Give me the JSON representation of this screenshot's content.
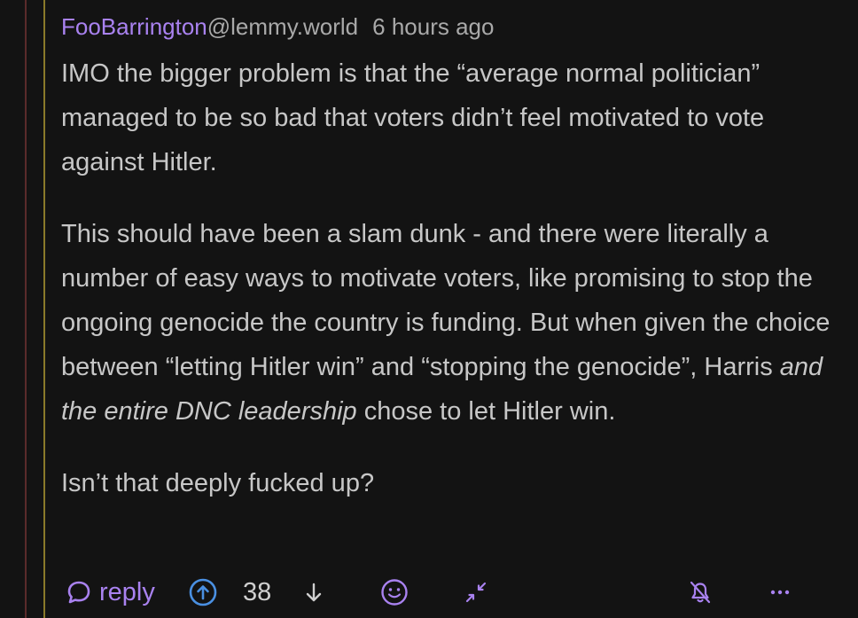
{
  "comment": {
    "username": "FooBarrington",
    "instance": "@lemmy.world",
    "timestamp": "6 hours ago",
    "paragraph1": "IMO the bigger problem is that the “average normal politician” managed to be so bad that voters didn’t feel motivated to vote against Hitler.",
    "paragraph2_before": "This should have been a slam dunk - and there were literally a number of easy ways to motivate voters, like promising to stop the ongoing genocide the country is funding. But when given the choice between “letting Hitler win” and “stopping the genocide”, Harris ",
    "paragraph2_emphasis": "and the entire DNC leadership",
    "paragraph2_after": " chose to let Hitler win.",
    "paragraph3": "Isn’t that deeply fucked up?"
  },
  "actions": {
    "reply_label": "reply",
    "score": "38"
  },
  "icons": {
    "reply": "speech-bubble-icon",
    "upvote": "arrow-up-circle-icon",
    "downvote": "arrow-down-icon",
    "emoji": "smiley-icon",
    "collapse": "collapse-arrows-icon",
    "mute": "bell-off-icon",
    "more": "more-dots-icon"
  },
  "colors": {
    "background": "#131313",
    "accent": "#a982f0",
    "upvote": "#4a90e2",
    "text": "#c7c7c7",
    "muted": "#a9a9a9"
  }
}
